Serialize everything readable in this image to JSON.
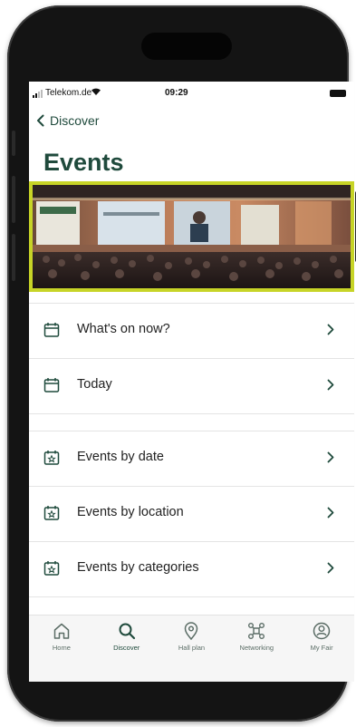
{
  "status": {
    "carrier": "Telekom.de",
    "time": "09:29"
  },
  "nav": {
    "back_label": "Discover"
  },
  "page": {
    "title": "Events"
  },
  "menu": {
    "groups": [
      [
        {
          "label": "What's on now?",
          "icon": "calendar-icon"
        },
        {
          "label": "Today",
          "icon": "calendar-icon"
        }
      ],
      [
        {
          "label": "Events by date",
          "icon": "calendar-star-icon"
        },
        {
          "label": "Events by location",
          "icon": "calendar-star-icon"
        },
        {
          "label": "Events by categories",
          "icon": "calendar-star-icon"
        }
      ]
    ]
  },
  "tabs": [
    {
      "label": "Home",
      "icon": "home-icon"
    },
    {
      "label": "Discover",
      "icon": "search-icon",
      "active": true
    },
    {
      "label": "Hall plan",
      "icon": "location-pin-icon"
    },
    {
      "label": "Networking",
      "icon": "network-icon"
    },
    {
      "label": "My Fair",
      "icon": "user-circle-icon"
    }
  ],
  "colors": {
    "brand_green": "#1f4a3c",
    "banner_border": "#c7d427"
  }
}
